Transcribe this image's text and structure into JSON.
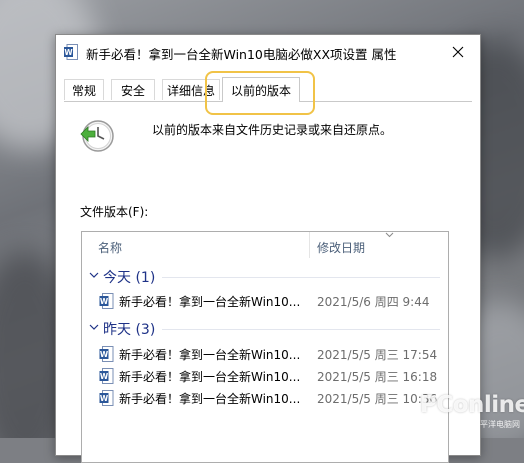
{
  "window": {
    "title": "新手必看！拿到一台全新Win10电脑必做XX项设置 属性",
    "icon": "word-document-icon"
  },
  "tabs": [
    {
      "label": "常规",
      "active": false
    },
    {
      "label": "安全",
      "active": false
    },
    {
      "label": "详细信息",
      "active": false
    },
    {
      "label": "以前的版本",
      "active": true
    }
  ],
  "previous_versions": {
    "description": "以前的版本来自文件历史记录或来自还原点。",
    "versions_label": "文件版本(F):",
    "columns": {
      "name": "名称",
      "modified": "修改日期"
    },
    "groups": [
      {
        "label": "今天 (1)",
        "items": [
          {
            "name": "新手必看！拿到一台全新Win10...",
            "date": "2021/5/6 周四 9:44"
          }
        ]
      },
      {
        "label": "昨天 (3)",
        "items": [
          {
            "name": "新手必看！拿到一台全新Win10...",
            "date": "2021/5/5 周三 17:54"
          },
          {
            "name": "新手必看！拿到一台全新Win10...",
            "date": "2021/5/5 周三 16:18"
          },
          {
            "name": "新手必看！拿到一台全新Win10...",
            "date": "2021/5/5 周三 10:36"
          }
        ]
      }
    ]
  },
  "watermark": {
    "text": "PConline",
    "subtext": "太平洋电脑网"
  },
  "colors": {
    "accent_highlight": "#f1c347",
    "group_text": "#1e3287",
    "word_blue": "#2b579a"
  }
}
